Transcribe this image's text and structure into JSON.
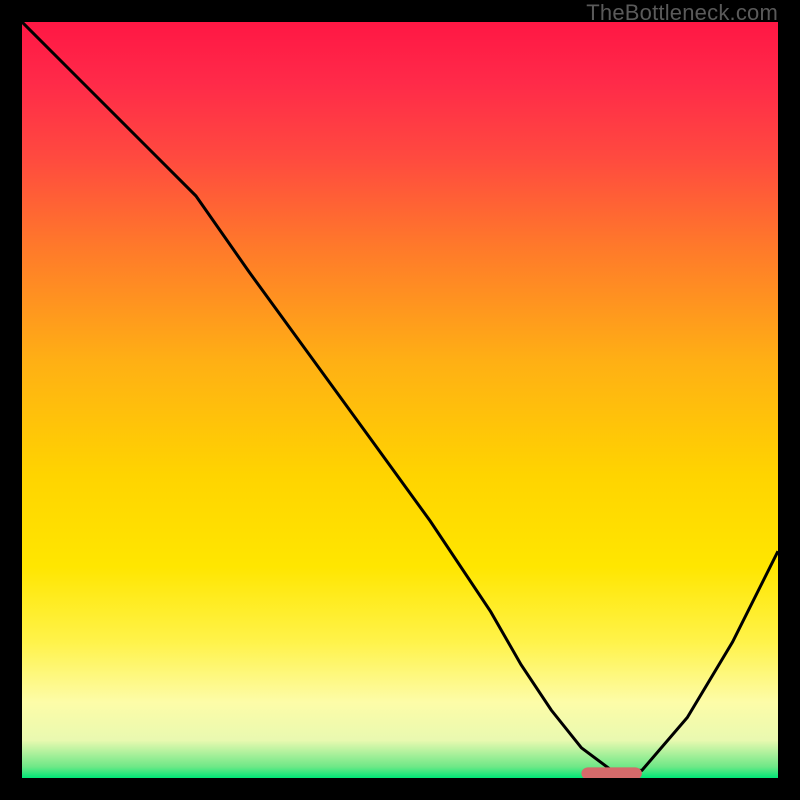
{
  "watermark": "TheBottleneck.com",
  "chart_data": {
    "type": "line",
    "title": "",
    "xlabel": "",
    "ylabel": "",
    "xlim": [
      0,
      100
    ],
    "ylim": [
      0,
      100
    ],
    "grid": false,
    "legend": false,
    "gradient_stops": [
      {
        "offset": 0.0,
        "color": "#ff1744"
      },
      {
        "offset": 0.08,
        "color": "#ff2a49"
      },
      {
        "offset": 0.18,
        "color": "#ff4a3f"
      },
      {
        "offset": 0.3,
        "color": "#ff7a2a"
      },
      {
        "offset": 0.45,
        "color": "#ffb014"
      },
      {
        "offset": 0.6,
        "color": "#ffd400"
      },
      {
        "offset": 0.72,
        "color": "#ffe600"
      },
      {
        "offset": 0.82,
        "color": "#fff34a"
      },
      {
        "offset": 0.9,
        "color": "#fdfca8"
      },
      {
        "offset": 0.95,
        "color": "#e9f9b0"
      },
      {
        "offset": 0.985,
        "color": "#6fe887"
      },
      {
        "offset": 1.0,
        "color": "#00e676"
      }
    ],
    "series": [
      {
        "name": "bottleneck-curve",
        "color": "#000000",
        "width": 3,
        "x": [
          0,
          8,
          16,
          23,
          30,
          38,
          46,
          54,
          62,
          66,
          70,
          74,
          78,
          82,
          88,
          94,
          100
        ],
        "y": [
          100,
          92,
          84,
          77,
          67,
          56,
          45,
          34,
          22,
          15,
          9,
          4,
          1,
          1,
          8,
          18,
          30
        ]
      }
    ],
    "marker": {
      "name": "optimal-range-marker",
      "color": "#d46a6a",
      "x_center": 78,
      "y_center": 0.6,
      "width": 8,
      "height": 1.6,
      "rx": 0.9
    }
  }
}
